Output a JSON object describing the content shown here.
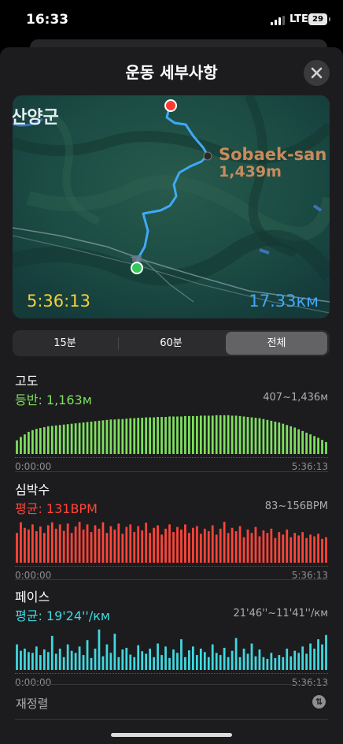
{
  "status": {
    "time": "16:33",
    "network": "LTE",
    "battery": "29"
  },
  "sheet": {
    "title": "운동 세부사항",
    "close_icon": "xmark-icon"
  },
  "map": {
    "town_label": "산양군",
    "peak_name": "Sobaek-san",
    "peak_elevation": "1,439m",
    "duration": "5:36:13",
    "distance": "17.33км",
    "route_color": "#3fa9f5",
    "start_color": "#34c759",
    "end_color": "#ff3b30"
  },
  "segments": {
    "options": [
      "15분",
      "60분",
      "전체"
    ],
    "selected": "전체"
  },
  "elevation": {
    "title": "고도",
    "stat": "등반: 1,163м",
    "range": "407~1,436м",
    "start_time": "0:00:00",
    "end_time": "5:36:13",
    "color": "#7ee05e",
    "values": [
      0.32,
      0.4,
      0.46,
      0.52,
      0.56,
      0.59,
      0.61,
      0.63,
      0.65,
      0.66,
      0.67,
      0.68,
      0.69,
      0.7,
      0.71,
      0.72,
      0.73,
      0.74,
      0.75,
      0.76,
      0.77,
      0.78,
      0.79,
      0.8,
      0.81,
      0.81,
      0.82,
      0.82,
      0.83,
      0.84,
      0.84,
      0.85,
      0.85,
      0.86,
      0.86,
      0.86,
      0.87,
      0.87,
      0.87,
      0.88,
      0.88,
      0.88,
      0.88,
      0.89,
      0.89,
      0.89,
      0.89,
      0.9,
      0.9,
      0.9,
      0.9,
      0.91,
      0.91,
      0.91,
      0.91,
      0.9,
      0.9,
      0.89,
      0.88,
      0.87,
      0.86,
      0.85,
      0.84,
      0.82,
      0.8,
      0.78,
      0.76,
      0.74,
      0.71,
      0.68,
      0.65,
      0.62,
      0.58,
      0.54,
      0.5,
      0.46,
      0.42,
      0.38,
      0.33,
      0.28
    ]
  },
  "heart_rate": {
    "title": "심박수",
    "stat": "평균: 131BPM",
    "range": "83~156BPM",
    "start_time": "0:00:00",
    "end_time": "5:36:13",
    "color": "#ff453a",
    "values": [
      0.7,
      0.95,
      0.82,
      0.78,
      0.9,
      0.74,
      0.85,
      0.7,
      0.88,
      0.95,
      0.8,
      0.9,
      0.75,
      0.92,
      0.7,
      0.85,
      0.96,
      0.78,
      0.9,
      0.72,
      0.88,
      0.8,
      0.95,
      0.7,
      0.86,
      0.78,
      0.92,
      0.68,
      0.84,
      0.9,
      0.72,
      0.86,
      0.76,
      0.94,
      0.7,
      0.82,
      0.88,
      0.66,
      0.8,
      0.9,
      0.72,
      0.84,
      0.78,
      0.9,
      0.7,
      0.82,
      0.86,
      0.68,
      0.8,
      0.74,
      0.88,
      0.66,
      0.8,
      0.96,
      0.7,
      0.82,
      0.74,
      0.86,
      0.6,
      0.78,
      0.7,
      0.84,
      0.62,
      0.76,
      0.7,
      0.8,
      0.58,
      0.72,
      0.66,
      0.78,
      0.6,
      0.7,
      0.64,
      0.72,
      0.58,
      0.66,
      0.62,
      0.68,
      0.56,
      0.6
    ]
  },
  "pace": {
    "title": "페이스",
    "stat": "평균: 19'24''/км",
    "range": "21'46''~11'41''/км",
    "start_time": "0:00:00",
    "end_time": "5:36:13",
    "color": "#40d9e0",
    "values": [
      0.6,
      0.45,
      0.5,
      0.42,
      0.4,
      0.55,
      0.35,
      0.48,
      0.42,
      0.8,
      0.38,
      0.5,
      0.3,
      0.6,
      0.45,
      0.4,
      0.55,
      0.35,
      0.7,
      0.28,
      0.5,
      0.95,
      0.32,
      0.6,
      0.4,
      0.85,
      0.3,
      0.48,
      0.52,
      0.36,
      0.3,
      0.58,
      0.44,
      0.38,
      0.5,
      0.3,
      0.62,
      0.35,
      0.55,
      0.28,
      0.48,
      0.4,
      0.72,
      0.3,
      0.46,
      0.55,
      0.35,
      0.5,
      0.42,
      0.3,
      0.6,
      0.4,
      0.35,
      0.52,
      0.3,
      0.45,
      0.75,
      0.3,
      0.5,
      0.38,
      0.62,
      0.32,
      0.48,
      0.3,
      0.26,
      0.4,
      0.28,
      0.35,
      0.3,
      0.5,
      0.32,
      0.45,
      0.4,
      0.55,
      0.38,
      0.62,
      0.5,
      0.72,
      0.6,
      0.82
    ]
  },
  "more": {
    "label": "재정렬",
    "icon": "swap-arrows-icon"
  }
}
